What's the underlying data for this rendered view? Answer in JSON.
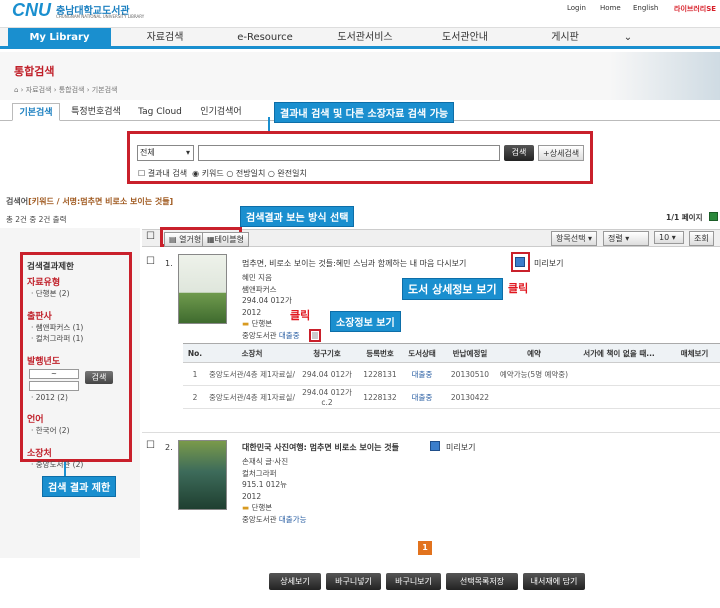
{
  "header": {
    "logo": "CNU",
    "univ_name": "충남대학교도서관",
    "univ_sub": "CHUNGNAM NATIONAL UNIVERSITY LIBRARY",
    "links": [
      "Login",
      "Home",
      "English"
    ],
    "library_label": "라이브러리SE"
  },
  "nav": {
    "my_library": "My Library",
    "items": [
      "자료검색",
      "e-Resource",
      "도서관서비스",
      "도서관안내",
      "게시판"
    ]
  },
  "page": {
    "title": "통합검색",
    "breadcrumb": [
      "자료검색",
      "통합검색",
      "기본검색"
    ]
  },
  "tabs": [
    "기본검색",
    "특정번호검색",
    "Tag Cloud",
    "인기검색어"
  ],
  "search": {
    "scope": "전체",
    "query": "",
    "button": "검색",
    "advanced": "+상세검색",
    "within_results": "결과내 검색",
    "modes": [
      "키워드",
      "전방일치",
      "완전일치"
    ],
    "selected_mode": "키워드"
  },
  "query_summary": {
    "label": "검색어",
    "text": "[키워드 / 서명:멈추면 비로소 보이는 것들]",
    "count": "총 2건 중 2건 출력",
    "pages": "1/1 페이지"
  },
  "view_toggle": {
    "list": "열거형",
    "tile": "테이블형"
  },
  "toolbar": {
    "item_select": "항목선택",
    "sort": "정렬",
    "per_page": "10",
    "go": "조회"
  },
  "facets": {
    "title": "검색결과제한",
    "groups": [
      {
        "name": "자료유형",
        "items": [
          "단행본 (2)"
        ]
      },
      {
        "name": "출판사",
        "items": [
          "쌤앤파커스 (1)",
          "컬처그라퍼 (1)"
        ]
      },
      {
        "name": "발행년도",
        "from": "",
        "to": "",
        "button": "검색",
        "items": [
          "2012 (2)"
        ]
      },
      {
        "name": "언어",
        "items": [
          "한국어 (2)"
        ]
      },
      {
        "name": "소장처",
        "items": [
          "중앙도서관 (2)"
        ]
      }
    ]
  },
  "results": [
    {
      "no": "1.",
      "title": "멈추면, 비로소 보이는 것들:혜민 스님과 함께하는 내 마음 다시보기",
      "preview": "미리보기",
      "author": "혜민 지음",
      "publisher": "쌤앤파커스",
      "call_no": "294.04 012가",
      "year": "2012",
      "type": "단행본",
      "location": "중앙도서관",
      "status": "대출중"
    },
    {
      "no": "2.",
      "title": "대한민국 사진여행: 멈추면 비로소 보이는 것들",
      "preview": "미리보기",
      "author": "손재식 글·사진",
      "publisher": "컬처그라퍼",
      "call_no": "915.1 012뉴",
      "year": "2012",
      "type": "단행본",
      "location": "중앙도서관",
      "status": "대출가능"
    }
  ],
  "holdings": {
    "headers": [
      "No.",
      "소장처",
      "청구기호",
      "등록번호",
      "도서상태",
      "반납예정일",
      "예약",
      "서가에 책이 없을 때...",
      "매체보기"
    ],
    "rows": [
      [
        "1",
        "중앙도서관/4층 제1자료실/",
        "294.04 012가",
        "1228131",
        "대출중",
        "20130510",
        "예약가능(5명 예약중)",
        "",
        ""
      ],
      [
        "2",
        "중앙도서관/4층 제1자료실/",
        "294.04 012가 c.2",
        "1228132",
        "대출중",
        "20130422",
        "",
        "",
        ""
      ]
    ]
  },
  "pagination": {
    "current": "1"
  },
  "bottom_buttons": [
    "상세보기",
    "바구니넣기",
    "바구니보기",
    "선택목록저장",
    "내서재에 담기"
  ],
  "annotations": {
    "search_note": "결과내 검색 및 다른 소장자료 검색 가능",
    "view_note": "검색결과 보는 방식 선택",
    "detail_note": "도서 상세정보 보기",
    "holding_note": "소장정보 보기",
    "facet_note": "검색 결과 제한",
    "click": "클릭"
  },
  "colors": {
    "nav_blue": "#1a8fcf",
    "annotation_red": "#c9202b",
    "title_red": "#c0202a"
  }
}
